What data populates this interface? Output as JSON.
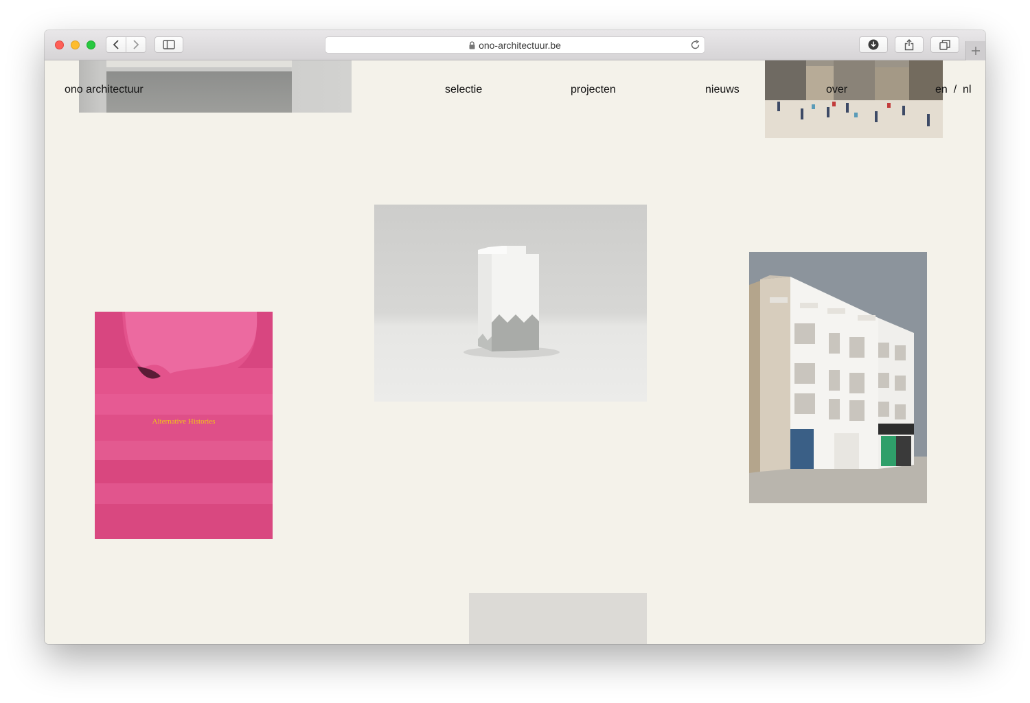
{
  "browser": {
    "url": "ono-architectuur.be"
  },
  "site": {
    "logo": "ono architectuur",
    "nav": {
      "selectie": "selectie",
      "projecten": "projecten",
      "nieuws": "nieuws",
      "over": "over"
    },
    "lang": {
      "en": "en",
      "separator": "/",
      "nl": "nl"
    }
  },
  "gallery": {
    "book_title": "Alternative Histories"
  },
  "colors": {
    "page_background": "#f4f2ea",
    "pink": "#e85a92",
    "book_title_yellow": "#f2c318"
  },
  "icons": {
    "back": "chevron-left-icon",
    "forward": "chevron-right-icon",
    "sidebar": "sidebar-icon",
    "lock": "lock-icon",
    "reload": "reload-icon",
    "download": "download-icon",
    "share": "share-icon",
    "tabs": "tabs-icon",
    "new_tab": "plus-icon"
  }
}
